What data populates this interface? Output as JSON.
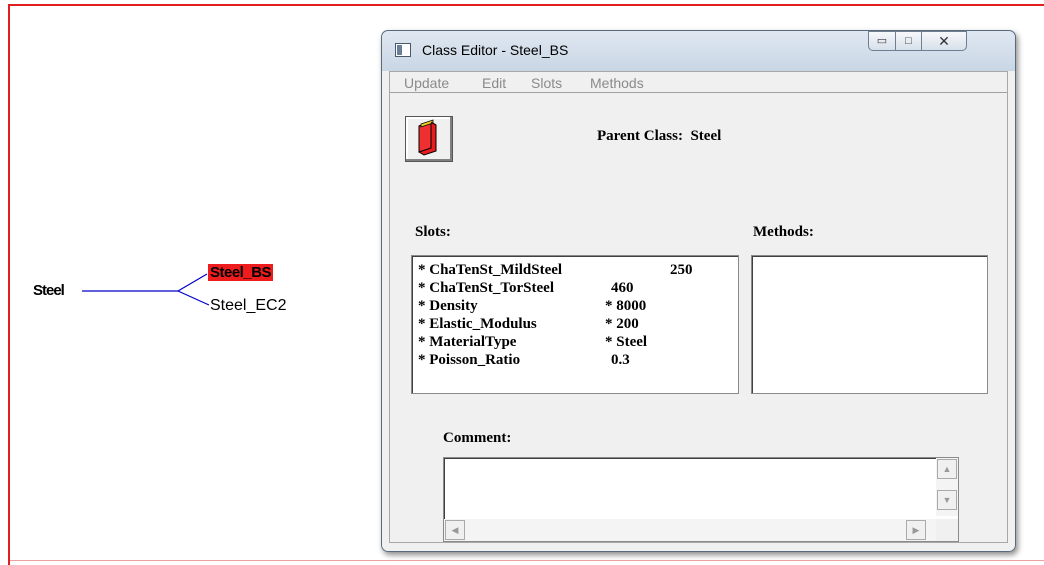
{
  "tree": {
    "root": "Steel",
    "children": [
      "Steel_BS",
      "Steel_EC2"
    ],
    "selected_color": "#ee1c1c",
    "line_color": "#0000cc"
  },
  "window": {
    "title": "Class Editor - Steel_BS",
    "controls": {
      "minimize": "minimize-icon",
      "maximize": "maximize-icon",
      "close": "close-icon"
    },
    "menu": [
      "Update",
      "Edit",
      "Slots",
      "Methods"
    ],
    "parent_class_label": "Parent Class:",
    "parent_class_value": "Steel",
    "slots_label": "Slots:",
    "methods_label": "Methods:",
    "slots": [
      {
        "name": "* ChaTenSt_MildSteel",
        "value": "250"
      },
      {
        "name": "* ChaTenSt_TorSteel",
        "value": "460"
      },
      {
        "name": "* Density",
        "value": "* 8000"
      },
      {
        "name": "* Elastic_Modulus",
        "value": "* 200"
      },
      {
        "name": "* MaterialType",
        "value": "* Steel"
      },
      {
        "name": "* Poisson_Ratio",
        "value": "0.3"
      }
    ],
    "methods": [],
    "comment_label": "Comment:",
    "comment_value": ""
  }
}
